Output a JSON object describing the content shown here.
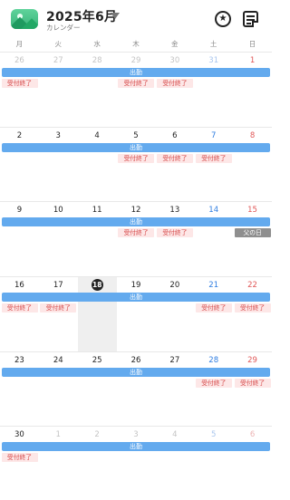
{
  "header": {
    "title": "2025年6月",
    "subtitle": "カレンダー"
  },
  "weekdays": [
    "月",
    "火",
    "水",
    "木",
    "金",
    "土",
    "日"
  ],
  "event_bar_label": "出勤",
  "tag_label": "受付終了",
  "holiday_label": "父の日",
  "weeks": [
    {
      "days": [
        {
          "n": "26",
          "muted": true
        },
        {
          "n": "27",
          "muted": true
        },
        {
          "n": "28",
          "muted": true
        },
        {
          "n": "29",
          "muted": true
        },
        {
          "n": "30",
          "muted": true
        },
        {
          "n": "31",
          "muted": true
        },
        {
          "n": "1"
        }
      ],
      "tags": [
        0,
        3,
        4
      ]
    },
    {
      "days": [
        {
          "n": "2"
        },
        {
          "n": "3"
        },
        {
          "n": "4"
        },
        {
          "n": "5"
        },
        {
          "n": "6"
        },
        {
          "n": "7"
        },
        {
          "n": "8"
        }
      ],
      "tags": [
        3,
        4,
        5
      ]
    },
    {
      "days": [
        {
          "n": "9"
        },
        {
          "n": "10"
        },
        {
          "n": "11"
        },
        {
          "n": "12"
        },
        {
          "n": "13"
        },
        {
          "n": "14"
        },
        {
          "n": "15"
        }
      ],
      "tags": [
        3,
        4
      ],
      "holiday": 6
    },
    {
      "days": [
        {
          "n": "16"
        },
        {
          "n": "17"
        },
        {
          "n": "18",
          "today": true
        },
        {
          "n": "19"
        },
        {
          "n": "20"
        },
        {
          "n": "21"
        },
        {
          "n": "22"
        }
      ],
      "tags": [
        0,
        1,
        5,
        6
      ]
    },
    {
      "days": [
        {
          "n": "23"
        },
        {
          "n": "24"
        },
        {
          "n": "25"
        },
        {
          "n": "26"
        },
        {
          "n": "27"
        },
        {
          "n": "28"
        },
        {
          "n": "29"
        }
      ],
      "tags": [
        5,
        6
      ]
    },
    {
      "days": [
        {
          "n": "30"
        },
        {
          "n": "1",
          "muted": true
        },
        {
          "n": "2",
          "muted": true
        },
        {
          "n": "3",
          "muted": true
        },
        {
          "n": "4",
          "muted": true
        },
        {
          "n": "5",
          "muted": true
        },
        {
          "n": "6",
          "muted": true
        }
      ],
      "tags": [
        0
      ]
    }
  ]
}
